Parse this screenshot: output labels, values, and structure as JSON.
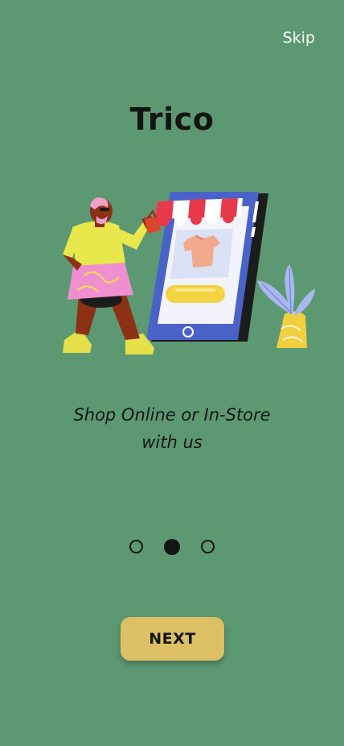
{
  "header": {
    "skip_label": "Skip"
  },
  "app": {
    "title": "Trico"
  },
  "onboarding": {
    "tagline_line1": "Shop Online or In-Store",
    "tagline_line2": "with us",
    "page_count": 3,
    "current_page": 2,
    "illustration": "shopping-phone-illustration"
  },
  "actions": {
    "next_label": "NEXT"
  },
  "colors": {
    "background": "#5c9973",
    "primary_button": "#dcc063",
    "text": "#141414",
    "skip_text": "#ffffff"
  }
}
